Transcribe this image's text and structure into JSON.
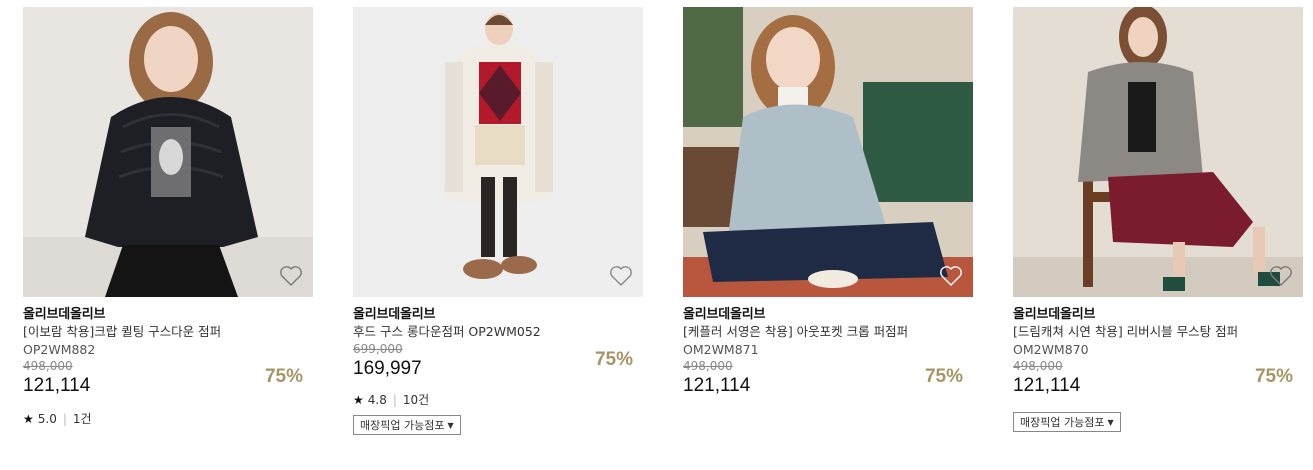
{
  "products": [
    {
      "brand": "올리브데올리브",
      "name": "[이보람 착용]크랍 퀼팅 구스다운 점퍼",
      "code": "OP2WM882",
      "original_price": "498,000",
      "sale_price": "121,114",
      "discount": "75%",
      "rating": "5.0",
      "review_count": "1건",
      "pickup_label": ""
    },
    {
      "brand": "올리브데올리브",
      "name": "후드 구스 롱다운점퍼 OP2WM052",
      "code": "",
      "original_price": "699,000",
      "sale_price": "169,997",
      "discount": "75%",
      "rating": "4.8",
      "review_count": "10건",
      "pickup_label": "매장픽업 가능점포"
    },
    {
      "brand": "올리브데올리브",
      "name": "[케플러 서영은 착용] 아웃포켓 크롭 퍼점퍼",
      "code": "OM2WM871",
      "original_price": "498,000",
      "sale_price": "121,114",
      "discount": "75%",
      "rating": "",
      "review_count": "",
      "pickup_label": ""
    },
    {
      "brand": "올리브데올리브",
      "name": "[드림캐쳐 시연 착용] 리버시블 무스탕 점퍼",
      "code": "OM2WM870",
      "original_price": "498,000",
      "sale_price": "121,114",
      "discount": "75%",
      "rating": "",
      "review_count": "",
      "pickup_label": "매장픽업 가능점포"
    }
  ],
  "colors": {
    "discount": "#a89565",
    "price": "#111111",
    "strike": "#888888"
  },
  "icons": {
    "wishlist": "heart-outline-icon",
    "star": "star-filled-icon",
    "dropdown": "triangle-down-icon"
  }
}
